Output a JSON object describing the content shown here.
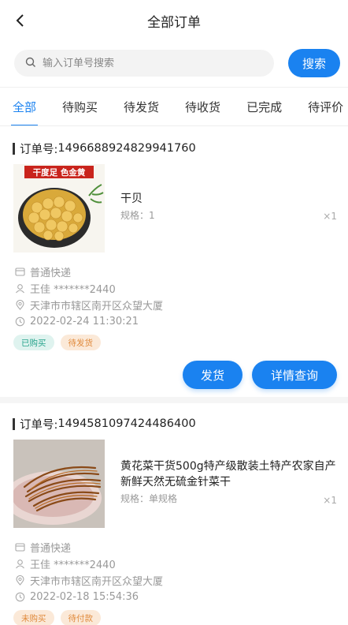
{
  "header": {
    "title": "全部订单",
    "back_icon": "chevron-left-icon"
  },
  "search": {
    "placeholder": "输入订单号搜索",
    "button_label": "搜索"
  },
  "tabs": [
    {
      "label": "全部",
      "active": true
    },
    {
      "label": "待购买"
    },
    {
      "label": "待发货"
    },
    {
      "label": "待收货"
    },
    {
      "label": "已完成"
    },
    {
      "label": "待评价"
    }
  ],
  "orders": [
    {
      "order_label": "订单号:",
      "order_no": "1496688924829941760",
      "product_name": "干贝",
      "spec": "规格：1",
      "qty": "×1",
      "image_banner": "干度足 色金黄",
      "shipping": "普通快递",
      "receiver": "王佳 *******2440",
      "address": "天津市市辖区南开区众望大厦",
      "time": "2022-02-24 11:30:21",
      "badges": [
        "已购买",
        "待发货"
      ],
      "actions": [
        "发货",
        "详情查询"
      ]
    },
    {
      "order_label": "订单号:",
      "order_no": "1494581097424486400",
      "product_name": "黄花菜干货500g特产级散装土特产农家自产新鲜天然无硫金针菜干",
      "spec": "规格：单规格",
      "qty": "×1",
      "shipping": "普通快递",
      "receiver": "王佳 *******2440",
      "address": "天津市市辖区南开区众望大厦",
      "time": "2022-02-18 15:54:36",
      "badges": [
        "未购买",
        "待付款"
      ]
    }
  ],
  "colors": {
    "accent": "#1a82f0",
    "green_badge": "#27a38c",
    "orange_badge": "#e08a3c"
  }
}
